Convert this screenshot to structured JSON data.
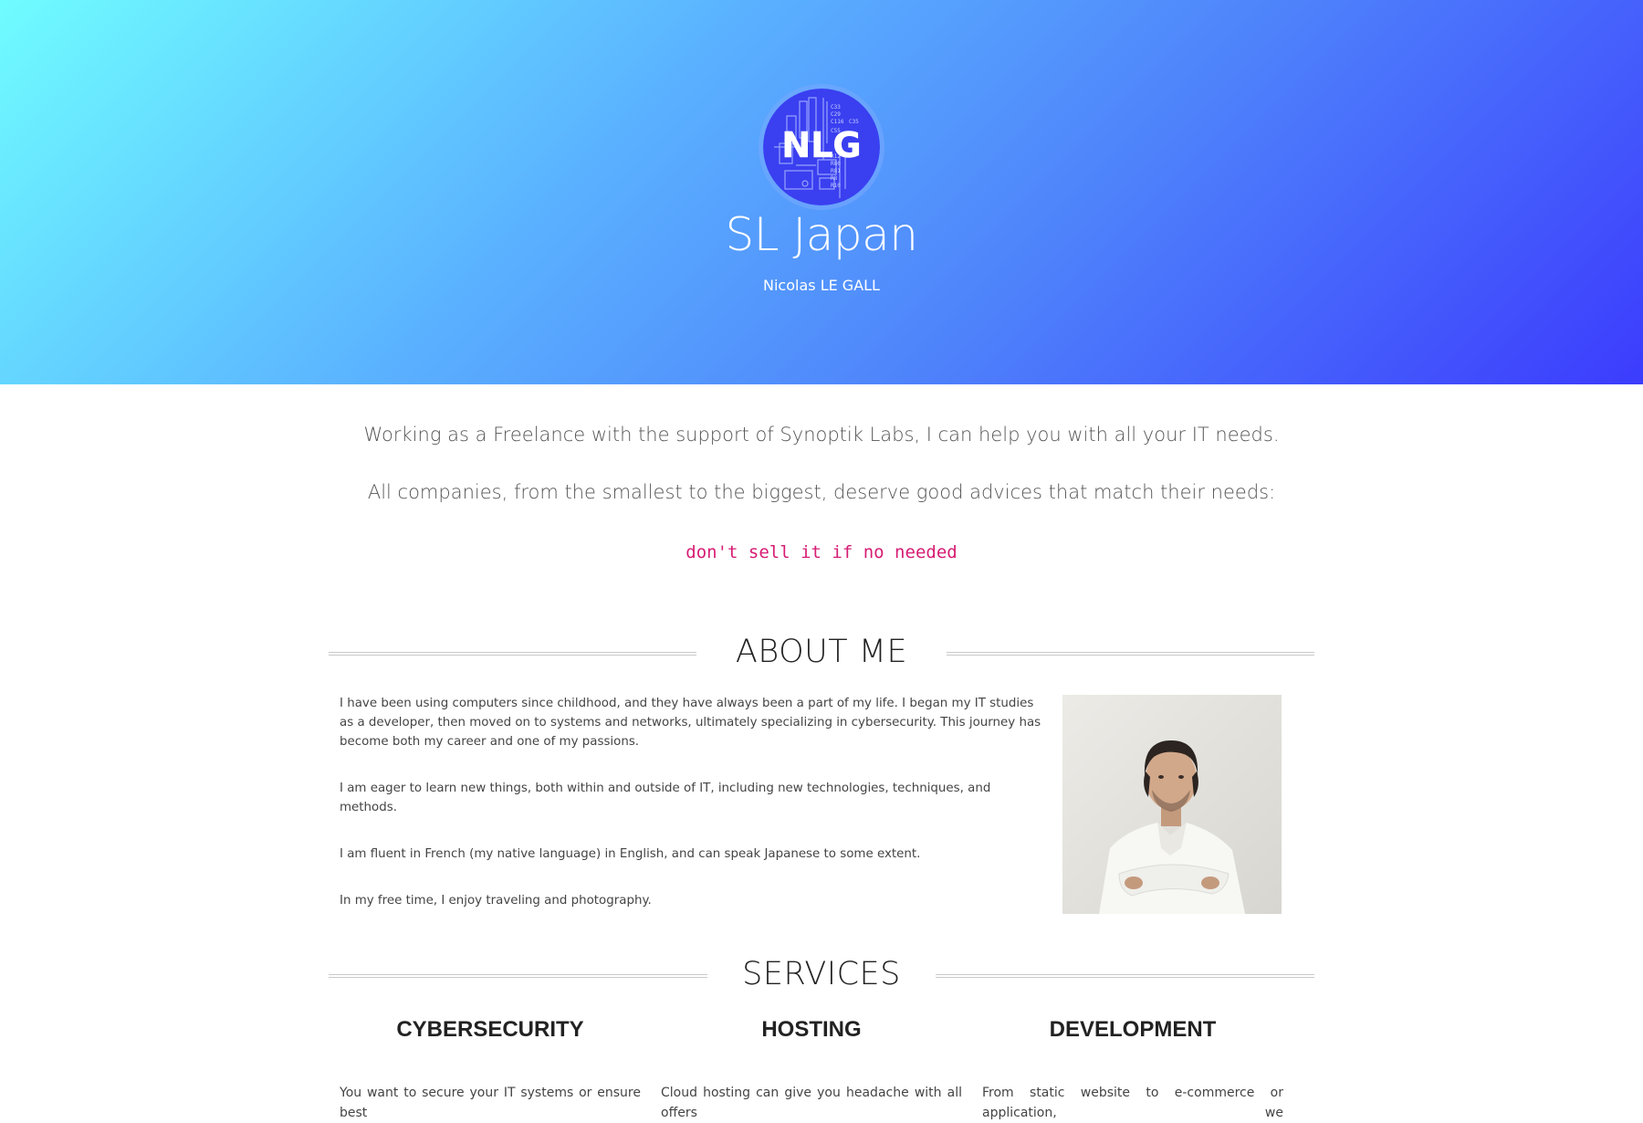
{
  "hero": {
    "logo_text": "NLG",
    "title": "SL Japan",
    "subtitle": "Nicolas LE GALL"
  },
  "intro": {
    "line1": "Working as a Freelance with the support of Synoptik Labs, I can help you with all your IT needs.",
    "line2": "All companies, from the smallest to the biggest, deserve good advices that match their needs:",
    "motto": "don't sell it if no needed"
  },
  "about": {
    "heading": "ABOUT ME",
    "paragraphs": [
      "I have been using computers since childhood, and they have always been a part of my life. I began my IT studies as a developer, then moved on to systems and networks, ultimately specializing in cybersecurity. This journey has become both my career and one of my passions.",
      "I am eager to learn new things, both within and outside of IT, including new technologies, techniques, and methods.",
      "I am fluent in French (my native language) in English, and can speak Japanese to some extent.",
      "In my free time, I enjoy traveling and photography."
    ]
  },
  "services": {
    "heading": "SERVICES",
    "items": [
      {
        "title": "CYBERSECURITY",
        "text": "You want to secure your IT systems or ensure best"
      },
      {
        "title": "HOSTING",
        "text": "Cloud hosting can give you headache with all offers"
      },
      {
        "title": "DEVELOPMENT",
        "text": "From static website to e-commerce or application, we"
      }
    ]
  },
  "colors": {
    "gradient_start": "#6ffcff",
    "gradient_end": "#3c3cfd",
    "motto": "#d61c74",
    "logo_bg": "#3a3ff0"
  }
}
